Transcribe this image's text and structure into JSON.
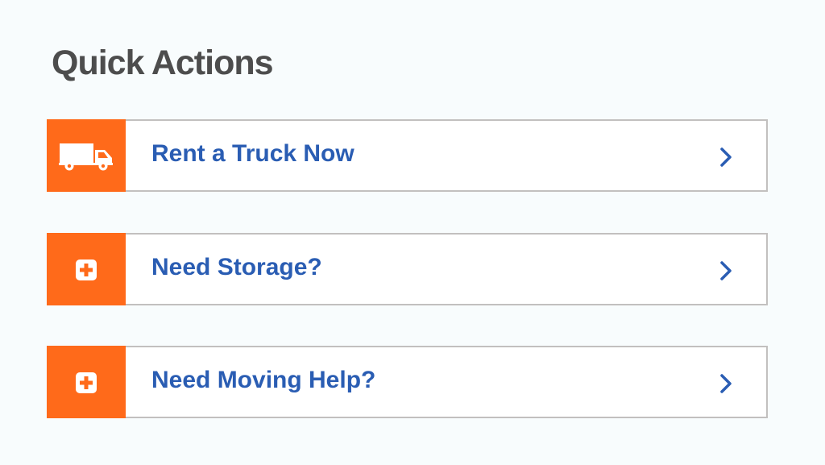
{
  "page": {
    "title": "Quick Actions"
  },
  "actions": [
    {
      "label": "Rent a Truck Now",
      "icon": "truck-icon",
      "chevron": "chevron-right-icon"
    },
    {
      "label": "Need Storage?",
      "icon": "plus-icon",
      "chevron": "chevron-right-icon"
    },
    {
      "label": "Need Moving Help?",
      "icon": "plus-icon",
      "chevron": "chevron-right-icon"
    }
  ],
  "colors": {
    "background": "#f8fcfd",
    "title": "#4d4d4d",
    "accent": "#ff6a1a",
    "link": "#2a5db3",
    "border": "#c2c0bf"
  }
}
